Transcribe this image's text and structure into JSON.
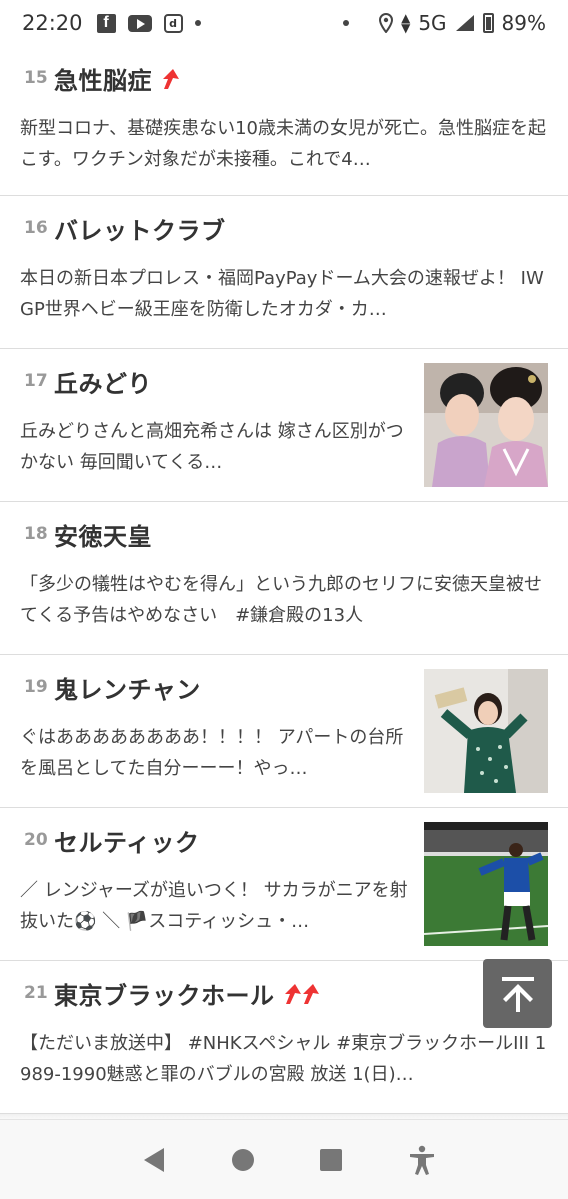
{
  "status_bar": {
    "time": "22:20",
    "fb_glyph": "f",
    "d_glyph": "d",
    "network": "5G",
    "battery": "89%",
    "icons": [
      "facebook-icon",
      "youtube-icon",
      "d-app-icon",
      "notification-dot-icon",
      "location-icon",
      "data-arrows-icon",
      "signal-icon",
      "battery-icon"
    ]
  },
  "trends": [
    {
      "rank": "15",
      "title": "急性脳症",
      "trend_up": 1,
      "desc": "新型コロナ、基礎疾患ない10歳未満の女児が死亡。急性脳症を起こす。ワクチン対象だが未接種。これで4…",
      "thumb": null
    },
    {
      "rank": "16",
      "title": "バレットクラブ",
      "trend_up": 0,
      "desc": "本日の新日本プロレス・福岡PayPayドーム大会の速報ぜよ！ IWGP世界ヘビー級王座を防衛したオカダ・カ…",
      "thumb": null
    },
    {
      "rank": "17",
      "title": "丘みどり",
      "trend_up": 0,
      "desc": "丘みどりさんと高畑充希さんは 嫁さん区別がつかない 毎回聞いてくる…",
      "thumb": "two-women-kimono-photo"
    },
    {
      "rank": "18",
      "title": "安徳天皇",
      "trend_up": 0,
      "desc": "「多少の犠牲はやむを得ん」という九郎のセリフに安徳天皇被せてくる予告はやめなさい　#鎌倉殿の13人",
      "thumb": null
    },
    {
      "rank": "19",
      "title": "鬼レンチャン",
      "trend_up": 0,
      "desc": "ぐはああああああああ！！！！ アパートの台所を風呂としてた自分ーーー！やっ…",
      "thumb": "woman-green-dress-photo"
    },
    {
      "rank": "20",
      "title": "セルティック",
      "trend_up": 0,
      "desc": "／ レンジャーズが追いつく！ サカラがニアを射抜いた⚽ ＼ 🏴スコティッシュ・…",
      "thumb": "soccer-player-photo"
    },
    {
      "rank": "21",
      "title": "東京ブラックホール",
      "trend_up": 2,
      "desc": "【ただいま放送中】 #NHKスペシャル #東京ブラックホールIII 1989-1990魅惑と罪のバブルの宮殿 放送 1(日)…",
      "thumb": null
    }
  ],
  "colors": {
    "trend_arrow": "#e33333",
    "rank": "#999999",
    "to_top_bg": "#666666"
  },
  "back_to_top_icon": "arrow-up-to-line-icon",
  "nav": [
    "back-icon",
    "home-icon",
    "recents-icon",
    "accessibility-icon"
  ]
}
